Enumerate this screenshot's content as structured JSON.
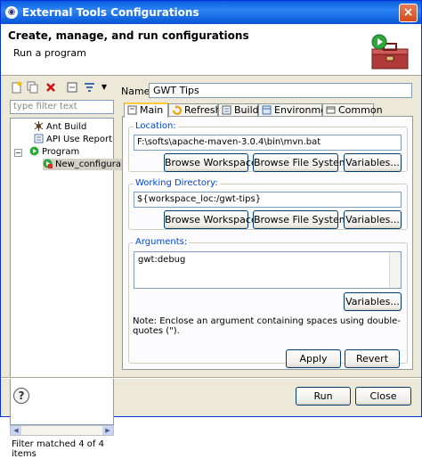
{
  "window": {
    "title": "External Tools Configurations",
    "close_glyph": "×"
  },
  "header": {
    "title": "Create, manage, and run configurations",
    "subtitle": "Run a program"
  },
  "left": {
    "toolbar_icons": [
      "new-configuration-icon",
      "duplicate-icon",
      "delete-icon",
      "collapse-all-icon",
      "filter-icon"
    ],
    "filter_placeholder": "type filter text",
    "tree": [
      {
        "label": "Ant Build",
        "level": 1,
        "icon": "ant-icon"
      },
      {
        "label": "API Use Report",
        "level": 1,
        "icon": "api-report-icon"
      },
      {
        "label": "Program",
        "level": 1,
        "icon": "program-icon",
        "expanded": true
      },
      {
        "label": "New_configura",
        "level": 2,
        "icon": "program-config-icon",
        "selected": true
      }
    ],
    "filter_status": "Filter matched 4 of 4 items"
  },
  "config": {
    "name_label": "Name:",
    "name_value": "GWT Tips",
    "tabs": [
      {
        "label": "Main",
        "icon": "main-tab-icon",
        "selected": true
      },
      {
        "label": "Refresh",
        "icon": "refresh-icon"
      },
      {
        "label": "Build",
        "icon": "build-icon"
      },
      {
        "label": "Environment",
        "icon": "environment-icon"
      },
      {
        "label": "Common",
        "icon": "common-icon"
      }
    ],
    "location": {
      "title": "Location:",
      "value": "F:\\softs\\apache-maven-3.0.4\\bin\\mvn.bat",
      "buttons": [
        "Browse Workspace...",
        "Browse File System...",
        "Variables..."
      ]
    },
    "working_directory": {
      "title": "Working Directory:",
      "value": "${workspace_loc:/gwt-tips}",
      "buttons": [
        "Browse Workspace...",
        "Browse File System...",
        "Variables..."
      ]
    },
    "arguments": {
      "title": "Arguments:",
      "value": "gwt:debug",
      "button": "Variables..."
    },
    "note": "Note: Enclose an argument containing spaces using double-quotes (\").",
    "apply_label": "Apply",
    "revert_label": "Revert"
  },
  "footer": {
    "help_glyph": "?",
    "run_label": "Run",
    "close_label": "Close"
  }
}
